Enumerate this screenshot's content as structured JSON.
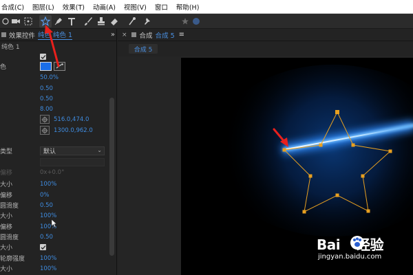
{
  "menu": {
    "items": [
      "合成(C)",
      "图层(L)",
      "效果(T)",
      "动画(A)",
      "视图(V)",
      "窗口",
      "帮助(H)"
    ]
  },
  "toolbar": {
    "tools": [
      "selection-icon",
      "camera-icon",
      "region-icon",
      "star-shape-icon",
      "pen-icon",
      "text-icon",
      "brush-icon",
      "clone-stamp-icon",
      "eraser-icon",
      "roto-brush-icon",
      "puppet-pin-icon"
    ],
    "active_tool": "star-shape-icon"
  },
  "effects_panel": {
    "title": "效果控件",
    "subtitle": "纯色 纯色 1",
    "more": "»",
    "layer_name": "纯色 1",
    "rows": {
      "r1_label": "",
      "r2_label": "色",
      "r3_label": "",
      "r3_value": "50.0%",
      "r4_label": "",
      "r4_value": "0.50",
      "r5_label": "",
      "r5_value": "0.50",
      "r6_label": "",
      "r6_value": "8.00",
      "r7_label": "",
      "r7_value": "516.0,474.0",
      "r8_label": "",
      "r8_value": "1300.0,962.0",
      "r9_label": "类型",
      "r9_value": "默认",
      "r10_label": "",
      "r11_label": "偏移",
      "r11_value": "0x+0.0°",
      "r12_label": "大小",
      "r12_value": "100%",
      "r13_label": "偏移",
      "r13_value": "0%",
      "r14_label": "圆滑度",
      "r14_value": "0.50",
      "r15_label": "大小",
      "r15_value": "100%",
      "r16_label": "偏移",
      "r16_value": "100%",
      "r17_label": "圆滑度",
      "r17_value": "0.50",
      "r18_label": "大小",
      "r19_label": "轮廓强度",
      "r19_value": "100%",
      "r20_label": "大小",
      "r20_value": "100%"
    }
  },
  "composition_panel": {
    "close": "×",
    "title": "合成",
    "subtitle": "合成 5",
    "more": "≡",
    "tab_label": "合成 5"
  },
  "colors": {
    "accent_blue": "#3f8ce0",
    "swatch_color": "#1a6ee8",
    "path_orange": "#e8a020",
    "annotation_red": "#e8201c"
  },
  "watermark": {
    "logo_left": "Bai",
    "logo_right": "经验",
    "url": "jingyan.baidu.com"
  }
}
